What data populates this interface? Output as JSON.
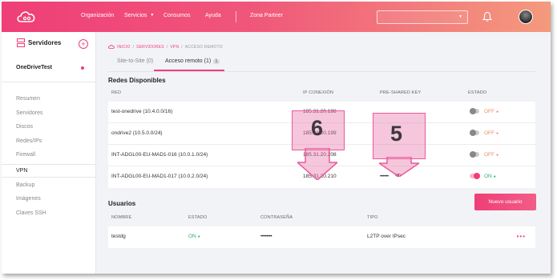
{
  "topbar": {
    "nav": [
      "Organización",
      "Servicios",
      "Consumos",
      "Ayuda",
      "Zona Partner"
    ],
    "icons": [
      "cloud-logo-icon",
      "bell-icon",
      "avatar"
    ]
  },
  "sidebar": {
    "header": "Servidores",
    "add_symbol": "+",
    "server_name": "OneDriveTest",
    "items": [
      "Resumen",
      "Servidores",
      "Discos",
      "Redes/IPs",
      "Firewall",
      "VPN",
      "Backup",
      "Imágenes",
      "Claves SSH"
    ],
    "active_item": "VPN"
  },
  "breadcrumb": {
    "items": [
      "INICIO",
      "SERVIDORES",
      "VPN"
    ],
    "current": "ACCESO REMOTO",
    "separator": "/"
  },
  "tabs": [
    {
      "label": "Site-to-Site (0)",
      "active": false
    },
    {
      "label": "Acceso remoto (1)",
      "badge": "1",
      "active": true
    }
  ],
  "networks": {
    "title": "Redes Disponibles",
    "columns": [
      "RED",
      "IP CONEXIÓN",
      "PRE-SHARED KEY",
      "ESTADO"
    ],
    "rows": [
      {
        "red": "test-onedrive (10.4.0.0/16)",
        "ip": "185.31.20.198",
        "key": "",
        "status": "OFF",
        "on": false
      },
      {
        "red": "ondrive2 (10.5.0.0/24)",
        "ip": "185.31.20.199",
        "key": "",
        "status": "OFF",
        "on": false
      },
      {
        "red": "INT-ADGL00-EU-MAD1-016 (10.0.1.0/24)",
        "ip": "185.31.20.208",
        "key": "",
        "status": "OFF",
        "on": false
      },
      {
        "red": "INT-ADGL00-EU-MAD1-017 (10.0.2.0/24)",
        "ip": "185.31.20.210",
        "key": "••••••",
        "status": "ON",
        "on": true
      }
    ]
  },
  "users": {
    "title": "Usuarios",
    "new_button": "Nuevo usuario",
    "columns": [
      "NOMBRE",
      "ESTADO",
      "CONTRASEÑA",
      "TIPO"
    ],
    "rows": [
      {
        "name": "testdg",
        "status": "ON",
        "password": "••••••••",
        "type": "L2TP over IPsec",
        "menu": "•••"
      }
    ]
  },
  "annotations": [
    {
      "number": "6",
      "target": "ip-connection"
    },
    {
      "number": "5",
      "target": "pre-shared-key"
    }
  ],
  "colors": {
    "accent": "#ef3e78",
    "off": "#f08a60",
    "on": "#2bb36a",
    "annotation_fill": "#ea78ac"
  }
}
